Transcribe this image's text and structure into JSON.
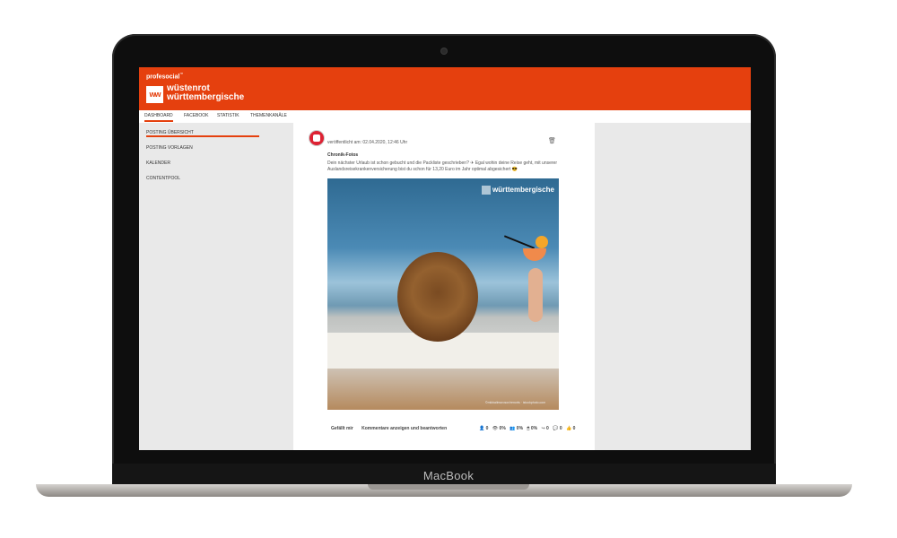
{
  "device": {
    "label": "MacBook"
  },
  "app": {
    "name": "profesocial",
    "name_sup": "™",
    "logo_mark": "ww",
    "logo_line1": "wüstenrot",
    "logo_line2": "württembergische"
  },
  "tabs": [
    "DASHBOARD",
    "FACEBOOK",
    "STATISTIK",
    "THEMENKANÄLE"
  ],
  "sidebar": {
    "items": [
      "POSTING ÜBERSICHT",
      "POSTING VORLAGEN",
      "KALENDER",
      "CONTENTPOOL"
    ]
  },
  "post": {
    "published": "veröffentlicht am: 02.04.2020, 12:46 Uhr",
    "title": "Chronik-Fotos",
    "text": "Dein nächster Urlaub ist schon gebucht und die Packliste geschrieben? ✈ Egal wohin deine Reise geht, mit unserer Auslandsreisekrankenversicherung bist du schon für 13,20 Euro im Jahr optimal abgesichert 😎",
    "watermark": "württembergische",
    "credit": "©mikhailmorosov/renorts · istockphoto.com",
    "actions": {
      "like": "Gefällt mir",
      "comments": "Kommentare anzeigen und beantworten"
    },
    "stats": [
      {
        "icon": "person-icon",
        "glyph": "👤",
        "value": "0"
      },
      {
        "icon": "eye-icon",
        "glyph": "👁",
        "value": "0%"
      },
      {
        "icon": "group-icon",
        "glyph": "👥",
        "value": "0%"
      },
      {
        "icon": "click-icon",
        "glyph": "🖱",
        "value": "0%"
      },
      {
        "icon": "share-icon",
        "glyph": "↪",
        "value": "0"
      },
      {
        "icon": "comment-icon",
        "glyph": "💬",
        "value": "0"
      },
      {
        "icon": "thumbs-up-icon",
        "glyph": "👍",
        "value": "0"
      }
    ]
  },
  "colors": {
    "brand": "#e5400e",
    "panel": "#e9e9e9"
  }
}
